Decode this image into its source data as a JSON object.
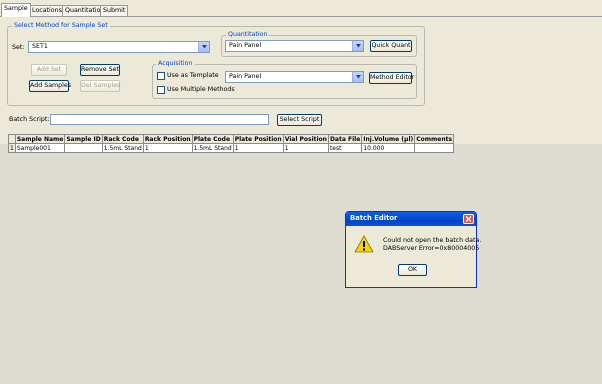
{
  "tabs": [
    "Sample",
    "Locations",
    "Quantitation",
    "Submit"
  ],
  "method_group": {
    "title": "Select Method for Sample Set",
    "set_label": "Set:",
    "set_value": "SET1",
    "buttons": {
      "add_set": "Add Set",
      "remove_set": "Remove Set",
      "add_samples": "Add Samples",
      "del_samples": "Del Samples"
    }
  },
  "quantitation_group": {
    "title": "Quantitation",
    "value": "Pain Panel",
    "quick_quant": "Quick Quant"
  },
  "acquisition_group": {
    "title": "Acquisition",
    "use_as_template": "Use as Template",
    "use_multiple_methods": "Use Multiple Methods",
    "value": "Pain Panel",
    "method_editor": "Method Editor"
  },
  "batch_script": {
    "label": "Batch Script:",
    "value": "",
    "select_script": "Select Script"
  },
  "grid": {
    "columns": [
      "",
      "Sample Name",
      "Sample ID",
      "Rack Code",
      "Rack Position",
      "Plate Code",
      "Plate Position",
      "Vial Position",
      "Data File",
      "Inj.Volume (µl)",
      "Comments"
    ],
    "rows": [
      [
        "1",
        "Sample001",
        "",
        "1.5mL Stand",
        "1",
        "1.5mL Stand",
        "1",
        "1",
        "test",
        "10.000",
        ""
      ]
    ]
  },
  "dialog": {
    "title": "Batch Editor",
    "message_line1": "Could not open the batch data.",
    "message_line2": "DABServer  Error=0x80004005",
    "ok": "OK"
  },
  "colors": {
    "window_bg": "#ece9d8",
    "group_title": "#0046d5",
    "dialog_title_bar": "#0044c8",
    "warning_icon": "#f5d50a"
  }
}
